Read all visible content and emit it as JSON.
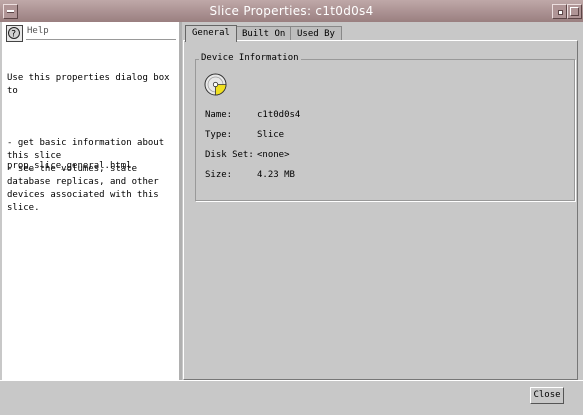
{
  "window": {
    "title": "Slice Properties: c1t0d0s4"
  },
  "help": {
    "title": "Help",
    "intro": "Use this properties dialog box to",
    "bullets": "- get basic information about this slice\n- see the volumes, state database replicas, and other devices associated with this slice.",
    "file": "prop_slice_general.html"
  },
  "tabs": [
    {
      "label": "General",
      "active": true
    },
    {
      "label": "Built On",
      "active": false
    },
    {
      "label": "Used By",
      "active": false
    }
  ],
  "device_info": {
    "legend": "Device Information",
    "icon": "disk-slice-icon",
    "fields": [
      {
        "label": "Name:",
        "value": "c1t0d0s4"
      },
      {
        "label": "Type:",
        "value": "Slice"
      },
      {
        "label": "Disk Set:",
        "value": "<none>"
      },
      {
        "label": "Size:",
        "value": "4.23 MB"
      }
    ]
  },
  "buttons": {
    "close": "Close"
  }
}
